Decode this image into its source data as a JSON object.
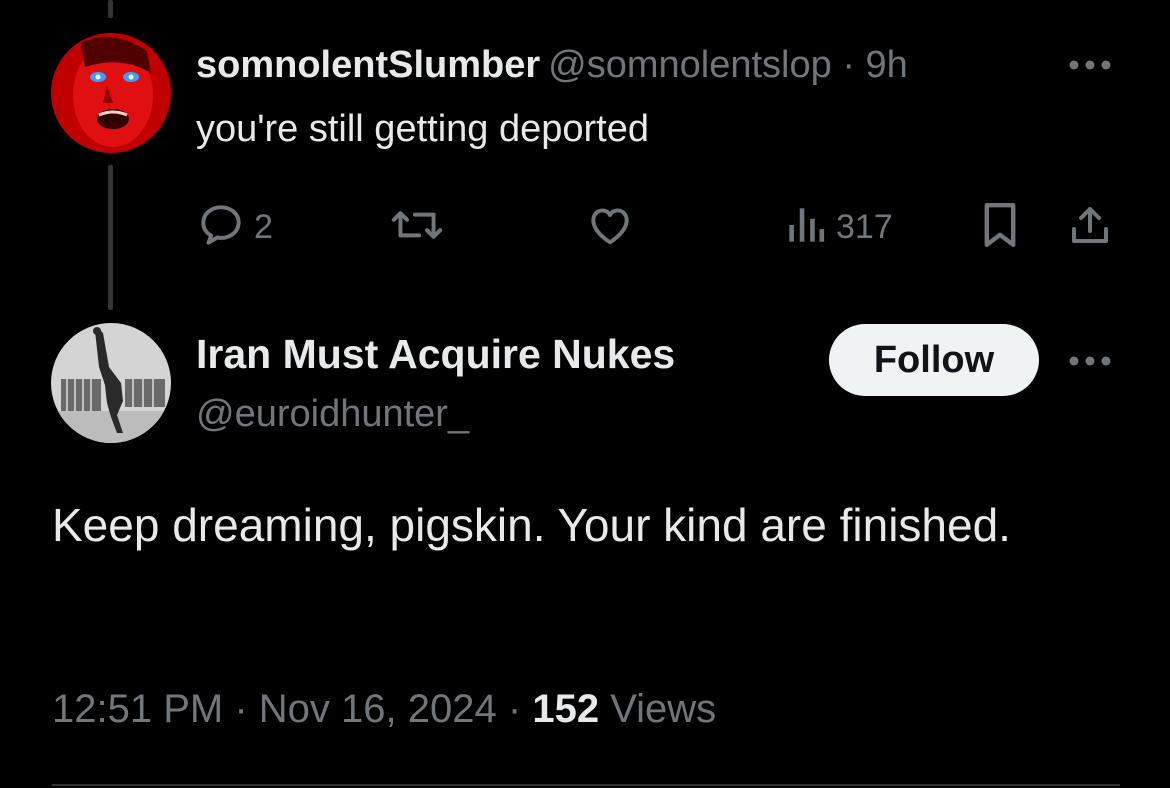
{
  "reply": {
    "display_name": "somnolentSlumber",
    "handle": "@somnolentslop",
    "separator": "·",
    "time": "9h",
    "text": "you're still getting deported",
    "stats": {
      "replies": "2",
      "views": "317"
    }
  },
  "main_tweet": {
    "display_name": "Iran Must Acquire Nukes",
    "handle": "@euroidhunter_",
    "follow_label": "Follow",
    "text": "Keep dreaming, pigskin. Your kind are finished.",
    "time": "12:51 PM",
    "date": "Nov 16, 2024",
    "meta_separator": "·",
    "views_count": "152",
    "views_label": "Views"
  },
  "colors": {
    "background": "#000000",
    "text_primary": "#e7e9ea",
    "text_secondary": "#71767b",
    "follow_button_bg": "#eff3f4",
    "follow_button_text": "#0f1419",
    "thread_line": "#333639"
  },
  "icons": {
    "reply": "speech-bubble-icon",
    "retweet": "retweet-icon",
    "like": "heart-icon",
    "views": "bar-chart-icon",
    "bookmark": "bookmark-icon",
    "share": "share-upload-icon",
    "more": "more-horizontal-icon"
  }
}
